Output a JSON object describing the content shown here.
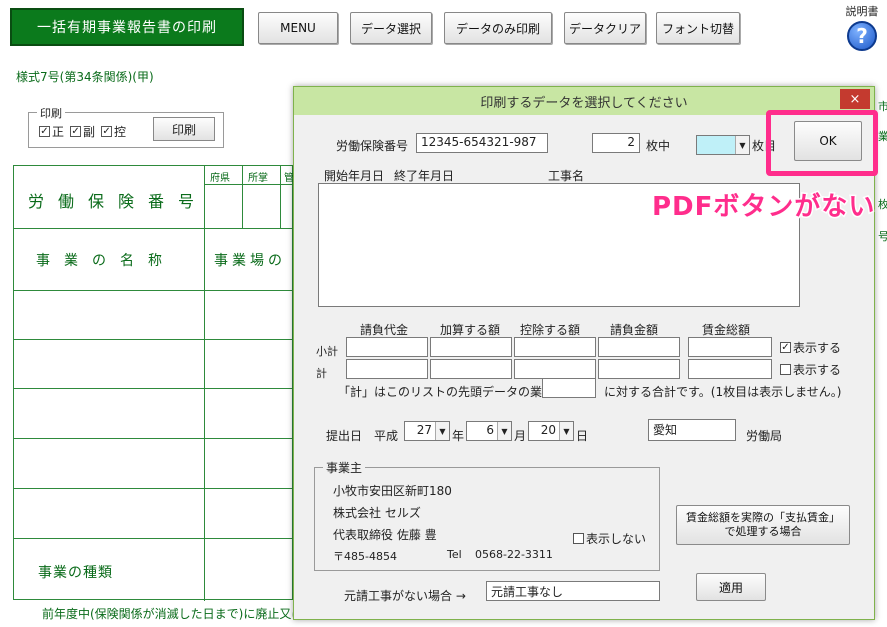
{
  "toolbar": {
    "title": "一括有期事業報告書の印刷",
    "menu": "MENU",
    "data_select": "データ選択",
    "data_only_print": "データのみ印刷",
    "data_clear": "データクリア",
    "font_toggle": "フォント切替",
    "help_label": "説明書",
    "help_glyph": "?"
  },
  "form": {
    "subtitle": "様式7号(第34条関係)(甲)",
    "print_group": {
      "legend": "印刷",
      "options": [
        {
          "label": "正",
          "checked": true
        },
        {
          "label": "副",
          "checked": true
        },
        {
          "label": "控",
          "checked": true
        }
      ],
      "button": "印刷"
    },
    "headers": [
      "府県",
      "所掌",
      "管"
    ],
    "labor_number_label": "労働保険番号",
    "business_name_label": "事業の名称",
    "site_label": "事業場の",
    "business_type_label": "事業の種類",
    "footer": "前年度中(保険関係が消滅した日まで)に廃止又は"
  },
  "dialog": {
    "title": "印刷するデータを選択してください",
    "close": "×",
    "labor_no_label": "労働保険番号",
    "labor_no_value": "12345-654321-987",
    "count_value": "2",
    "count_suffix": "枚中",
    "page_suffix": "枚目",
    "ok": "OK",
    "list_headers": {
      "start": "開始年月日",
      "end": "終了年月日",
      "name": "工事名"
    },
    "col_headers": [
      "請負代金",
      "加算する額",
      "控除する額",
      "請負金額",
      "賃金総額"
    ],
    "subtotal_label": "小計",
    "total_label": "計",
    "show_subtotal": "表示する",
    "show_total": "表示する",
    "note_prefix": "「計」はこのリストの先頭データの業種番号",
    "note_suffix": "に対する合計です。(1枚目は表示しません。)",
    "submit_label": "提出日",
    "era": "平成",
    "year": "27",
    "year_unit": "年",
    "month": "6",
    "month_unit": "月",
    "day": "20",
    "day_unit": "日",
    "bureau_value": "愛知",
    "bureau_suffix": "労働局",
    "owner": {
      "legend": "事業主",
      "address": "小牧市安田区新町180",
      "company": "株式会社 セルズ",
      "representative": "代表取締役 佐藤 豊",
      "postal": "〒485-4854",
      "tel_label": "Tel",
      "tel": "0568-22-3311",
      "hide_label": "表示しない"
    },
    "wage_button": "賃金総額を実際の「支払賃金」で処理する場合",
    "no_prime_label": "元請工事がない場合 →",
    "no_prime_value": "元請工事なし",
    "apply": "適用"
  },
  "annotation": {
    "callout": "PDFボタンがない",
    "color": "#ff2d8c"
  },
  "right_fragments": [
    "市",
    "業",
    "枚",
    "号"
  ]
}
